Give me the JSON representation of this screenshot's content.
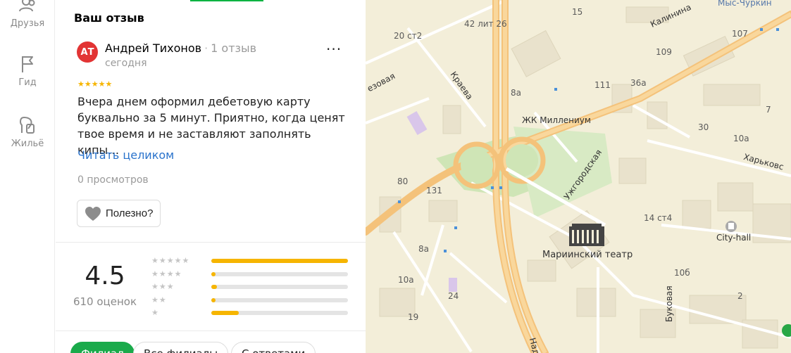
{
  "nav": {
    "items": [
      {
        "label": "Друзья",
        "icon": "friends-icon"
      },
      {
        "label": "Гид",
        "icon": "flag-icon"
      },
      {
        "label": "Жильё",
        "icon": "housing-icon"
      }
    ]
  },
  "review": {
    "section_title": "Ваш отзыв",
    "avatar_initials": "АТ",
    "author_name": "Андрей Тихонов",
    "separator": "·",
    "author_reviews": "1 отзыв",
    "date": "сегодня",
    "stars": 5,
    "stars_text": "★★★★★",
    "more_label": "···",
    "text_lines": [
      "Вчера днем оформил дебетовую карту",
      "буквально за 5 минут. Приятно, когда ценят",
      "твое время и не заставляют заполнять кипы…"
    ],
    "read_more": "Читать целиком",
    "views": "0 просмотров",
    "useful_label": "Полезно?"
  },
  "rating": {
    "value": "4.5",
    "count": "610 оценок",
    "distribution": [
      {
        "stars": "★★★★★",
        "fraction": 1.0
      },
      {
        "stars": "★★★★",
        "fraction": 0.03
      },
      {
        "stars": "★★★",
        "fraction": 0.04
      },
      {
        "stars": "★★",
        "fraction": 0.03
      },
      {
        "stars": "★",
        "fraction": 0.2
      }
    ]
  },
  "filters": {
    "chips": [
      {
        "label": "Филиал",
        "active": true
      },
      {
        "label": "Все филиалы",
        "active": false
      },
      {
        "label": "С ответами",
        "active": false
      }
    ]
  },
  "map": {
    "labels": {
      "top_right": "Мыс-Чуркин",
      "kalinina": "Калинина",
      "num_15": "15",
      "num_107": "107",
      "num_20ct2": "20 ст2",
      "num_42lit26": "42 лит 26",
      "num_109": "109",
      "kraeva": "Краева",
      "rezovaya": "езовая",
      "num_8a_top": "8а",
      "num_111": "111",
      "num_36a": "36а",
      "num_7": "7",
      "zhk": "ЖК Миллениум",
      "num_30": "30",
      "num_10a_right": "10а",
      "kharkovskaya": "Харьковс",
      "uzhgorodskaya": "Ужгородская",
      "num_80": "80",
      "num_131": "131",
      "num_14ct4": "14 ст4",
      "cityhall": "City-hall",
      "mariinsky": "Мариинский театр",
      "num_8a_mid": "8а",
      "num_10a_left": "10а",
      "num_24": "24",
      "num_19": "19",
      "bukovaya": "Буковая",
      "num_10b": "10б",
      "num_2": "2",
      "nad": "Над"
    }
  }
}
